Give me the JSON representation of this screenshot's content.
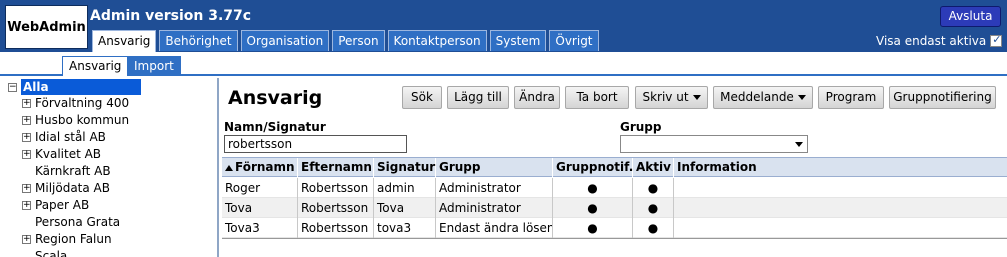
{
  "header": {
    "logo": "WebAdmin",
    "title": "Admin version 3.77c",
    "exit_label": "Avsluta",
    "show_active_label": "Visa endast aktiva",
    "show_active_checked": true,
    "tabs": [
      {
        "label": "Ansvarig",
        "active": true
      },
      {
        "label": "Behörighet",
        "active": false
      },
      {
        "label": "Organisation",
        "active": false
      },
      {
        "label": "Person",
        "active": false
      },
      {
        "label": "Kontaktperson",
        "active": false
      },
      {
        "label": "System",
        "active": false
      },
      {
        "label": "Övrigt",
        "active": false
      }
    ]
  },
  "subtabs": [
    {
      "label": "Ansvarig",
      "active": true
    },
    {
      "label": "Import",
      "active": false
    }
  ],
  "tree": {
    "root": "Alla",
    "items": [
      {
        "label": "Förvaltning 400",
        "expandable": true
      },
      {
        "label": "Husbo kommun",
        "expandable": true
      },
      {
        "label": "Idial stål AB",
        "expandable": true
      },
      {
        "label": "Kvalitet AB",
        "expandable": true
      },
      {
        "label": "Kärnkraft AB",
        "expandable": false
      },
      {
        "label": "Miljödata AB",
        "expandable": true
      },
      {
        "label": "Paper AB",
        "expandable": true
      },
      {
        "label": "Persona Grata",
        "expandable": false
      },
      {
        "label": "Region Falun",
        "expandable": true
      },
      {
        "label": "Scala",
        "expandable": false
      }
    ]
  },
  "main": {
    "title": "Ansvarig",
    "toolbar": {
      "search": "Sök",
      "add": "Lägg till",
      "change": "Ändra",
      "remove": "Ta bort",
      "print": "Skriv ut",
      "message": "Meddelande",
      "program": "Program",
      "group_notify": "Gruppnotifiering"
    },
    "filters": {
      "name_label": "Namn/Signatur",
      "name_value": "robertsson",
      "group_label": "Grupp",
      "group_value": ""
    },
    "columns": [
      "Förnamn",
      "Efternamn",
      "Signatur",
      "Grupp",
      "Gruppnotif.",
      "Aktiv",
      "Information"
    ],
    "rows": [
      {
        "first": "Roger",
        "last": "Robertsson",
        "signature": "admin",
        "group": "Administrator",
        "group_notif": "●",
        "active": "●",
        "info": ""
      },
      {
        "first": "Tova",
        "last": "Robertsson",
        "signature": "Tova",
        "group": "Administrator",
        "group_notif": "●",
        "active": "●",
        "info": ""
      },
      {
        "first": "Tova3",
        "last": "Robertsson",
        "signature": "tova3",
        "group": "Endast ändra lösen",
        "group_notif": "●",
        "active": "●",
        "info": ""
      }
    ]
  }
}
